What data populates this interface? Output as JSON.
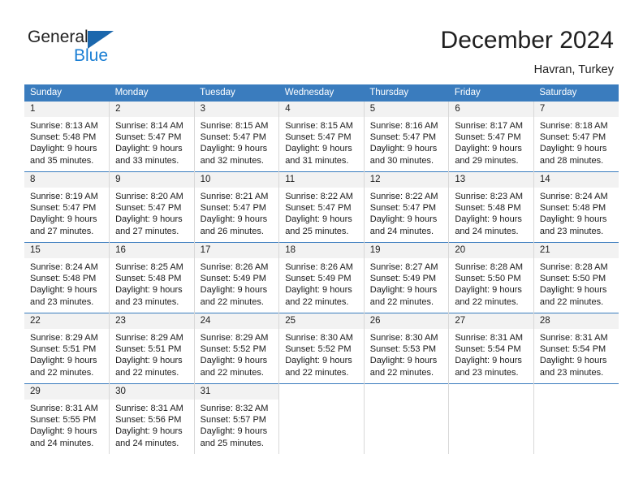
{
  "brand": {
    "name_part1": "General",
    "name_part2": "Blue",
    "accent_color": "#1b7fd4",
    "triangle_color": "#1b67ad"
  },
  "header": {
    "title": "December 2024",
    "location": "Havran, Turkey"
  },
  "calendar": {
    "header_bg": "#3a7cbe",
    "daynum_bg": "#f2f2f2",
    "weekdays": [
      "Sunday",
      "Monday",
      "Tuesday",
      "Wednesday",
      "Thursday",
      "Friday",
      "Saturday"
    ],
    "weeks": [
      [
        {
          "day": "1",
          "sunrise": "Sunrise: 8:13 AM",
          "sunset": "Sunset: 5:48 PM",
          "daylight1": "Daylight: 9 hours",
          "daylight2": "and 35 minutes."
        },
        {
          "day": "2",
          "sunrise": "Sunrise: 8:14 AM",
          "sunset": "Sunset: 5:47 PM",
          "daylight1": "Daylight: 9 hours",
          "daylight2": "and 33 minutes."
        },
        {
          "day": "3",
          "sunrise": "Sunrise: 8:15 AM",
          "sunset": "Sunset: 5:47 PM",
          "daylight1": "Daylight: 9 hours",
          "daylight2": "and 32 minutes."
        },
        {
          "day": "4",
          "sunrise": "Sunrise: 8:15 AM",
          "sunset": "Sunset: 5:47 PM",
          "daylight1": "Daylight: 9 hours",
          "daylight2": "and 31 minutes."
        },
        {
          "day": "5",
          "sunrise": "Sunrise: 8:16 AM",
          "sunset": "Sunset: 5:47 PM",
          "daylight1": "Daylight: 9 hours",
          "daylight2": "and 30 minutes."
        },
        {
          "day": "6",
          "sunrise": "Sunrise: 8:17 AM",
          "sunset": "Sunset: 5:47 PM",
          "daylight1": "Daylight: 9 hours",
          "daylight2": "and 29 minutes."
        },
        {
          "day": "7",
          "sunrise": "Sunrise: 8:18 AM",
          "sunset": "Sunset: 5:47 PM",
          "daylight1": "Daylight: 9 hours",
          "daylight2": "and 28 minutes."
        }
      ],
      [
        {
          "day": "8",
          "sunrise": "Sunrise: 8:19 AM",
          "sunset": "Sunset: 5:47 PM",
          "daylight1": "Daylight: 9 hours",
          "daylight2": "and 27 minutes."
        },
        {
          "day": "9",
          "sunrise": "Sunrise: 8:20 AM",
          "sunset": "Sunset: 5:47 PM",
          "daylight1": "Daylight: 9 hours",
          "daylight2": "and 27 minutes."
        },
        {
          "day": "10",
          "sunrise": "Sunrise: 8:21 AM",
          "sunset": "Sunset: 5:47 PM",
          "daylight1": "Daylight: 9 hours",
          "daylight2": "and 26 minutes."
        },
        {
          "day": "11",
          "sunrise": "Sunrise: 8:22 AM",
          "sunset": "Sunset: 5:47 PM",
          "daylight1": "Daylight: 9 hours",
          "daylight2": "and 25 minutes."
        },
        {
          "day": "12",
          "sunrise": "Sunrise: 8:22 AM",
          "sunset": "Sunset: 5:47 PM",
          "daylight1": "Daylight: 9 hours",
          "daylight2": "and 24 minutes."
        },
        {
          "day": "13",
          "sunrise": "Sunrise: 8:23 AM",
          "sunset": "Sunset: 5:48 PM",
          "daylight1": "Daylight: 9 hours",
          "daylight2": "and 24 minutes."
        },
        {
          "day": "14",
          "sunrise": "Sunrise: 8:24 AM",
          "sunset": "Sunset: 5:48 PM",
          "daylight1": "Daylight: 9 hours",
          "daylight2": "and 23 minutes."
        }
      ],
      [
        {
          "day": "15",
          "sunrise": "Sunrise: 8:24 AM",
          "sunset": "Sunset: 5:48 PM",
          "daylight1": "Daylight: 9 hours",
          "daylight2": "and 23 minutes."
        },
        {
          "day": "16",
          "sunrise": "Sunrise: 8:25 AM",
          "sunset": "Sunset: 5:48 PM",
          "daylight1": "Daylight: 9 hours",
          "daylight2": "and 23 minutes."
        },
        {
          "day": "17",
          "sunrise": "Sunrise: 8:26 AM",
          "sunset": "Sunset: 5:49 PM",
          "daylight1": "Daylight: 9 hours",
          "daylight2": "and 22 minutes."
        },
        {
          "day": "18",
          "sunrise": "Sunrise: 8:26 AM",
          "sunset": "Sunset: 5:49 PM",
          "daylight1": "Daylight: 9 hours",
          "daylight2": "and 22 minutes."
        },
        {
          "day": "19",
          "sunrise": "Sunrise: 8:27 AM",
          "sunset": "Sunset: 5:49 PM",
          "daylight1": "Daylight: 9 hours",
          "daylight2": "and 22 minutes."
        },
        {
          "day": "20",
          "sunrise": "Sunrise: 8:28 AM",
          "sunset": "Sunset: 5:50 PM",
          "daylight1": "Daylight: 9 hours",
          "daylight2": "and 22 minutes."
        },
        {
          "day": "21",
          "sunrise": "Sunrise: 8:28 AM",
          "sunset": "Sunset: 5:50 PM",
          "daylight1": "Daylight: 9 hours",
          "daylight2": "and 22 minutes."
        }
      ],
      [
        {
          "day": "22",
          "sunrise": "Sunrise: 8:29 AM",
          "sunset": "Sunset: 5:51 PM",
          "daylight1": "Daylight: 9 hours",
          "daylight2": "and 22 minutes."
        },
        {
          "day": "23",
          "sunrise": "Sunrise: 8:29 AM",
          "sunset": "Sunset: 5:51 PM",
          "daylight1": "Daylight: 9 hours",
          "daylight2": "and 22 minutes."
        },
        {
          "day": "24",
          "sunrise": "Sunrise: 8:29 AM",
          "sunset": "Sunset: 5:52 PM",
          "daylight1": "Daylight: 9 hours",
          "daylight2": "and 22 minutes."
        },
        {
          "day": "25",
          "sunrise": "Sunrise: 8:30 AM",
          "sunset": "Sunset: 5:52 PM",
          "daylight1": "Daylight: 9 hours",
          "daylight2": "and 22 minutes."
        },
        {
          "day": "26",
          "sunrise": "Sunrise: 8:30 AM",
          "sunset": "Sunset: 5:53 PM",
          "daylight1": "Daylight: 9 hours",
          "daylight2": "and 22 minutes."
        },
        {
          "day": "27",
          "sunrise": "Sunrise: 8:31 AM",
          "sunset": "Sunset: 5:54 PM",
          "daylight1": "Daylight: 9 hours",
          "daylight2": "and 23 minutes."
        },
        {
          "day": "28",
          "sunrise": "Sunrise: 8:31 AM",
          "sunset": "Sunset: 5:54 PM",
          "daylight1": "Daylight: 9 hours",
          "daylight2": "and 23 minutes."
        }
      ],
      [
        {
          "day": "29",
          "sunrise": "Sunrise: 8:31 AM",
          "sunset": "Sunset: 5:55 PM",
          "daylight1": "Daylight: 9 hours",
          "daylight2": "and 24 minutes."
        },
        {
          "day": "30",
          "sunrise": "Sunrise: 8:31 AM",
          "sunset": "Sunset: 5:56 PM",
          "daylight1": "Daylight: 9 hours",
          "daylight2": "and 24 minutes."
        },
        {
          "day": "31",
          "sunrise": "Sunrise: 8:32 AM",
          "sunset": "Sunset: 5:57 PM",
          "daylight1": "Daylight: 9 hours",
          "daylight2": "and 25 minutes."
        },
        {
          "day": "",
          "sunrise": "",
          "sunset": "",
          "daylight1": "",
          "daylight2": ""
        },
        {
          "day": "",
          "sunrise": "",
          "sunset": "",
          "daylight1": "",
          "daylight2": ""
        },
        {
          "day": "",
          "sunrise": "",
          "sunset": "",
          "daylight1": "",
          "daylight2": ""
        },
        {
          "day": "",
          "sunrise": "",
          "sunset": "",
          "daylight1": "",
          "daylight2": ""
        }
      ]
    ]
  }
}
